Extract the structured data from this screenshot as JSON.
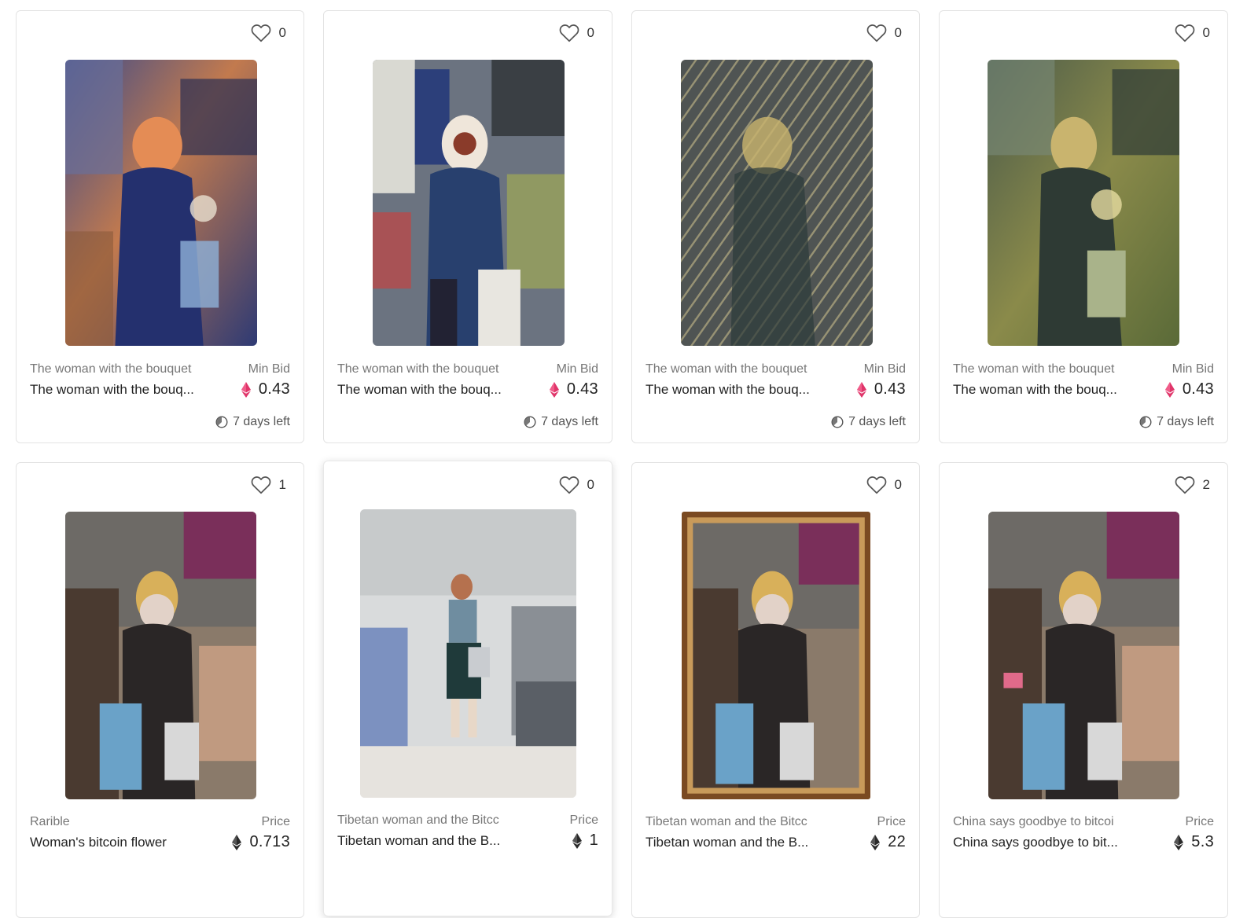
{
  "cards": [
    {
      "likes": "0",
      "collection": "The woman with the bouquet",
      "title": "The woman with the bouq...",
      "price_label": "Min Bid",
      "price": "0.43",
      "currency": "eth-pink",
      "time_left": "7 days left"
    },
    {
      "likes": "0",
      "collection": "The woman with the bouquet",
      "title": "The woman with the bouq...",
      "price_label": "Min Bid",
      "price": "0.43",
      "currency": "eth-pink",
      "time_left": "7 days left"
    },
    {
      "likes": "0",
      "collection": "The woman with the bouquet",
      "title": "The woman with the bouq...",
      "price_label": "Min Bid",
      "price": "0.43",
      "currency": "eth-pink",
      "time_left": "7 days left"
    },
    {
      "likes": "0",
      "collection": "The woman with the bouquet",
      "title": "The woman with the bouq...",
      "price_label": "Min Bid",
      "price": "0.43",
      "currency": "eth-pink",
      "time_left": "7 days left"
    },
    {
      "likes": "1",
      "collection": "Rarible",
      "title": "Woman's bitcoin flower",
      "price_label": "Price",
      "price": "0.713",
      "currency": "eth-black"
    },
    {
      "likes": "0",
      "collection": "Tibetan woman and the Bitcc",
      "title": "Tibetan woman and the B...",
      "price_label": "Price",
      "price": "1",
      "currency": "eth-black"
    },
    {
      "likes": "0",
      "collection": "Tibetan woman and the Bitcc",
      "title": "Tibetan woman and the B...",
      "price_label": "Price",
      "price": "22",
      "currency": "eth-black"
    },
    {
      "likes": "2",
      "collection": "China says goodbye to bitcoi",
      "title": "China says goodbye to bit...",
      "price_label": "Price",
      "price": "5.3",
      "currency": "eth-black"
    }
  ],
  "colors": {
    "eth_pink": "#e0356a",
    "eth_black": "#2a2a2a",
    "border": "#e3e3e3"
  },
  "icons": {
    "like": "heart-outline-icon",
    "currency": "ethereum-icon",
    "timer": "timer-icon"
  }
}
